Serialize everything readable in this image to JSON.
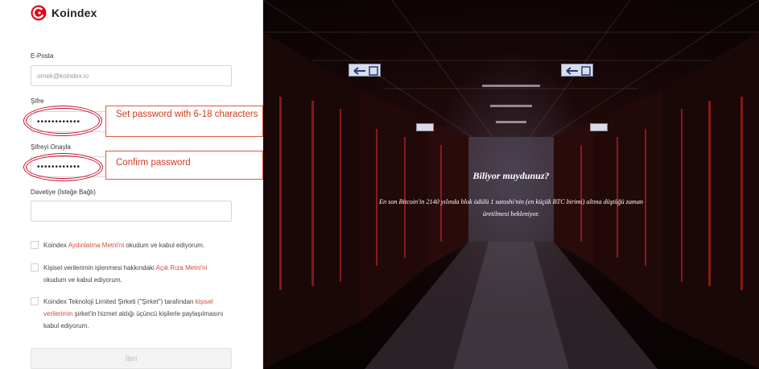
{
  "brand": {
    "name": "Koindex",
    "color": "#e30613"
  },
  "form": {
    "email_label": "E-Posta",
    "email_placeholder": "ornek@koindex.io",
    "password_label": "Şifre",
    "password_value": "••••••••••••",
    "confirm_label": "Şifreyi Onayla",
    "confirm_value": "••••••••••••",
    "invite_label": "Davetiye (İsteğe Bağlı)",
    "invite_value": "",
    "checks": [
      {
        "pre": "Koindex ",
        "link": "Aydınlatma Metni'ni",
        "post": " okudum ve kabul ediyorum."
      },
      {
        "pre": "Kişisel verilerimin işlenmesi hakkındaki ",
        "link": "Açık Rıza Metni'ni",
        "post": " okudum ve kabul ediyorum."
      },
      {
        "pre": "Koindex Teknoloji Limited Şirketi (\"Şirket\") tarafından ",
        "link": "kişisel verilerimin",
        "post": " şirket'in hizmet aldığı üçüncü kişilerle paylaşılmasını kabul ediyorum."
      }
    ],
    "next_label": "İleri"
  },
  "annotations": {
    "password_hint": "Set password with 6-18 characters",
    "confirm_hint": "Confirm password",
    "color": "#d23a1e"
  },
  "tip": {
    "title": "Biliyor muydunuz?",
    "body": "En son Bitcoin'in 2140 yılında blok ödülü 1 satoshi'nin (en küçük BTC birimi) altına düştüğü zaman üretilmesi bekleniyor."
  }
}
